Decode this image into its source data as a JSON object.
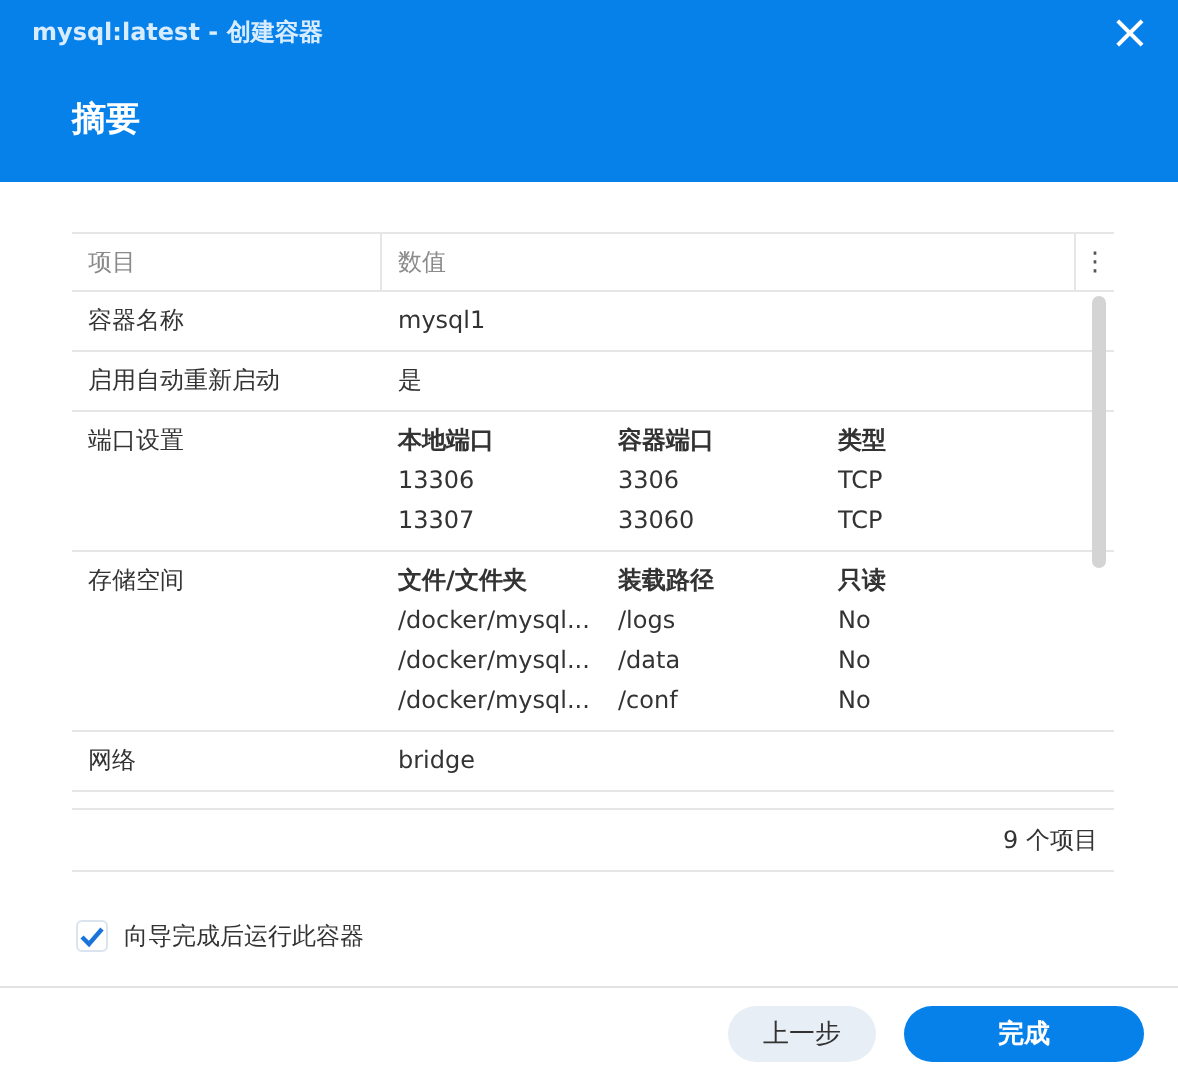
{
  "window": {
    "title": "mysql:latest - 创建容器",
    "close": "×"
  },
  "header": {
    "title": "摘要"
  },
  "table": {
    "columns": [
      "项目",
      "数值"
    ],
    "menu": "⋮",
    "rows": [
      {
        "kind": "text",
        "item": "容器名称",
        "value": "mysql1"
      },
      {
        "kind": "text",
        "item": "启用自动重新启动",
        "value": "是"
      },
      {
        "kind": "subtable",
        "item": "端口设置",
        "columns": [
          "本地端口",
          "容器端口",
          "类型"
        ],
        "rows": [
          [
            "13306",
            "3306",
            "TCP"
          ],
          [
            "13307",
            "33060",
            "TCP"
          ]
        ]
      },
      {
        "kind": "subtable",
        "item": "存储空间",
        "columns": [
          "文件/文件夹",
          "装载路径",
          "只读"
        ],
        "rows": [
          [
            "/docker/mysql...",
            "/logs",
            "No"
          ],
          [
            "/docker/mysql...",
            "/data",
            "No"
          ],
          [
            "/docker/mysql...",
            "/conf",
            "No"
          ]
        ]
      },
      {
        "kind": "text",
        "item": "网络",
        "value": "bridge"
      }
    ],
    "footer": "9 个项目"
  },
  "run_after": {
    "label": "向导完成后运行此容器",
    "checked": true
  },
  "buttons": [
    {
      "label": "上一步",
      "kind": "secondary"
    },
    {
      "label": "完成",
      "kind": "primary"
    }
  ]
}
